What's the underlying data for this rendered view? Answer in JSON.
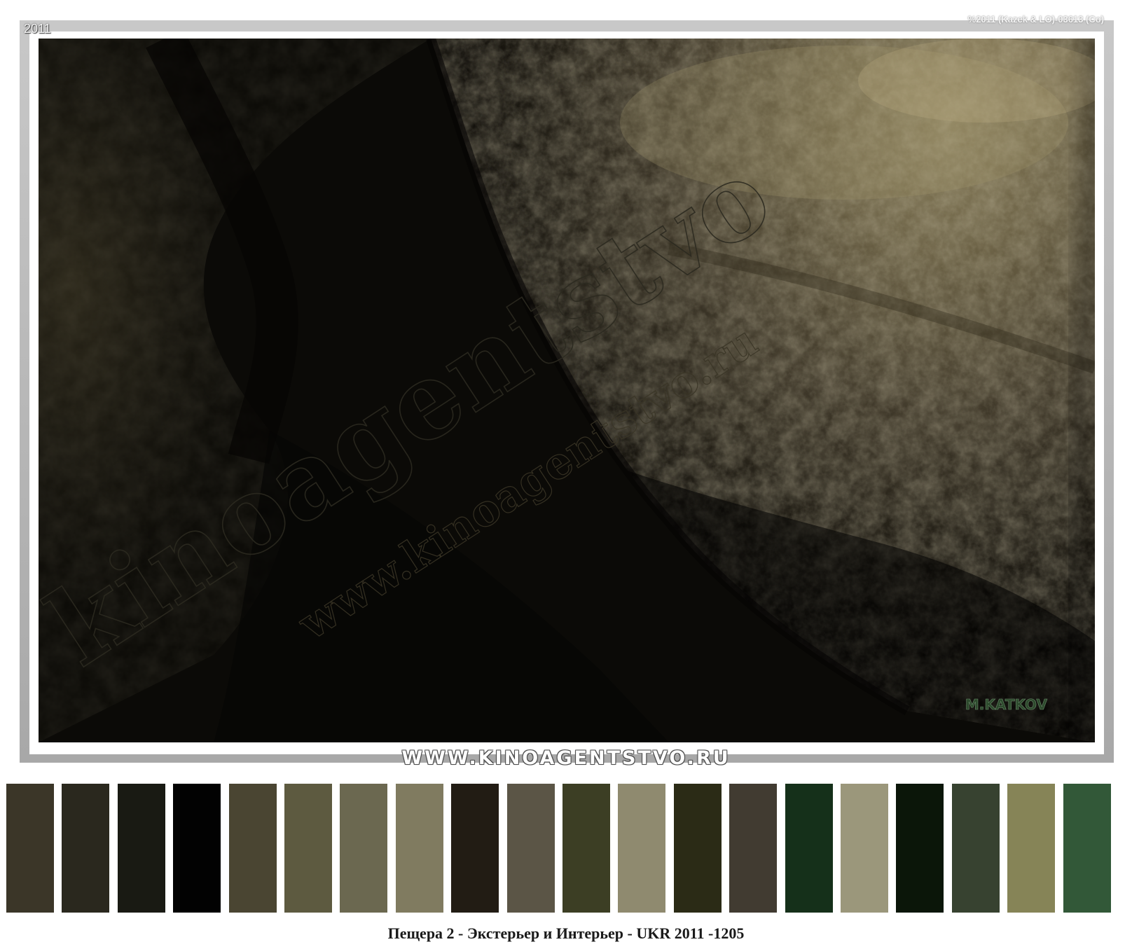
{
  "photo": {
    "year_stamp": "2011",
    "copyright_stamp": "%2011 (Kazek & LO)-03613 (Co)",
    "signature": "M.KATKOV",
    "watermark_large": "kinoagentstvo",
    "watermark_small": "www.kinoagentstvo.ru"
  },
  "banner": {
    "site": "WWW.KINOAGENTSTVO.RU"
  },
  "palette": {
    "colors": [
      "#3b3628",
      "#2a281e",
      "#191a13",
      "#020202",
      "#4a4532",
      "#5d5a40",
      "#6b6850",
      "#807b60",
      "#221c14",
      "#5b5546",
      "#3c3e24",
      "#8f8a6f",
      "#2b2b16",
      "#413b31",
      "#15301a",
      "#9b977b",
      "#0b1609",
      "#374230",
      "#868457",
      "#325838"
    ]
  },
  "caption": {
    "text": "Пещера 2 - Экстерьер и Интерьер - UKR 2011 -1205"
  },
  "colors": {
    "frame_border": "#b4b4b4",
    "rock_highlight": "#7a7050",
    "shadow": "#0c0b08",
    "signature_green": "#3a5a3a"
  }
}
